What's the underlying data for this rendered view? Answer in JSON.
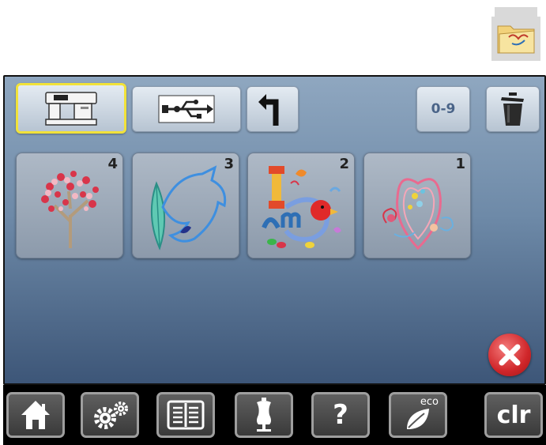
{
  "toolbar": {
    "range_button_label": "0-9"
  },
  "designs": [
    {
      "number": "4",
      "icon": "cherry-blossom-tree"
    },
    {
      "number": "3",
      "icon": "dolphin-and-feather"
    },
    {
      "number": "2",
      "icon": "i-am-letters-with-bird"
    },
    {
      "number": "1",
      "icon": "paisley-heart"
    }
  ],
  "bottom_bar": {
    "help_label": "?",
    "eco_label": "eco",
    "clear_label": "clr"
  },
  "colors": {
    "selection_border": "#f1e23a",
    "cancel_red": "#d0262a",
    "screen_top": "#8fa7c0",
    "screen_bottom": "#3d5678"
  }
}
